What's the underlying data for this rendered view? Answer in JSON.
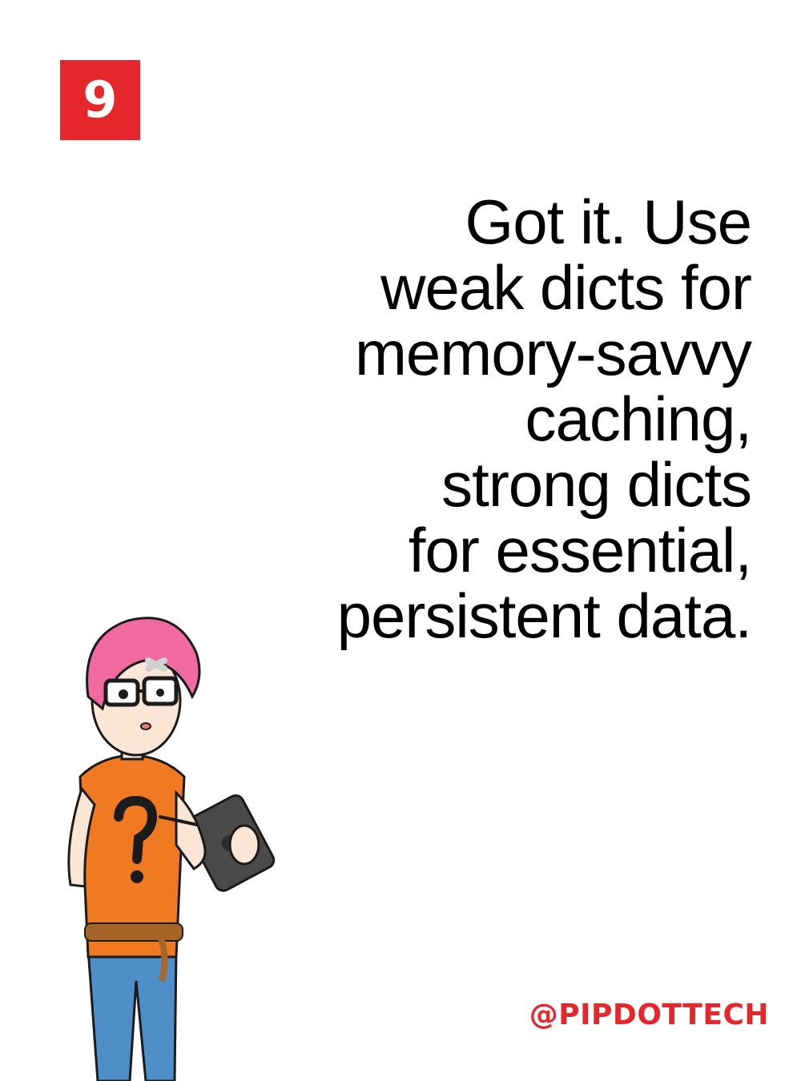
{
  "page": {
    "number": "9"
  },
  "message": {
    "lines": [
      "Got it. Use",
      "weak dicts for",
      "memory-savvy",
      "caching,",
      "strong dicts",
      "for essential,",
      "persistent data."
    ]
  },
  "footer": {
    "handle": "@PIPDOTTECH"
  },
  "colors": {
    "accent": "#e5262b",
    "hair": "#f06aa0",
    "shirt": "#f07a22",
    "jeans": "#4e8ec9"
  },
  "illustration": {
    "subject": "pink-haired-person-with-tablet"
  }
}
